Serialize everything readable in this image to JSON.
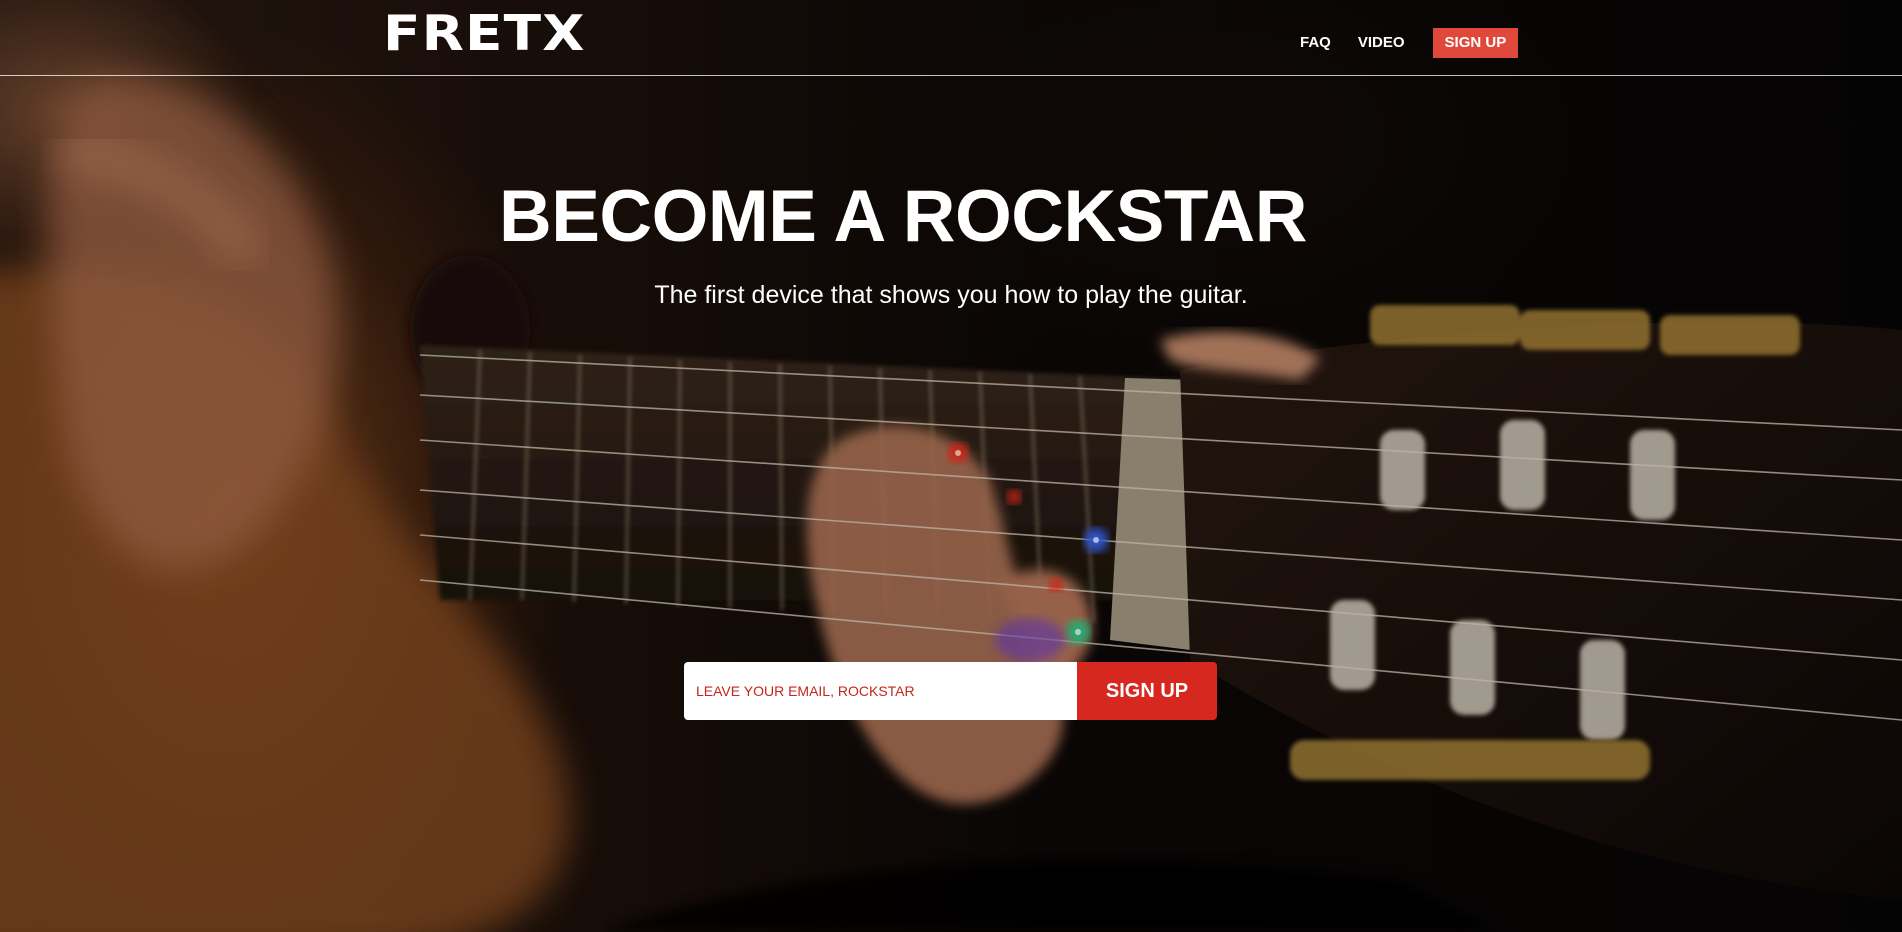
{
  "header": {
    "logo_text": "FRETX",
    "nav": {
      "faq_label": "FAQ",
      "video_label": "VIDEO",
      "signup_label": "SIGN UP"
    }
  },
  "hero": {
    "title": "BECOME A ROCKSTAR",
    "subtitle": "The first device that shows you how to play the guitar."
  },
  "signup_form": {
    "email_placeholder": "LEAVE YOUR EMAIL, ROCKSTAR",
    "submit_label": "SIGN UP"
  },
  "colors": {
    "accent": "#e0483c",
    "button": "#d7281f",
    "text": "#ffffff"
  },
  "background": {
    "image_subject": "guitar-fretboard-with-led-lights"
  }
}
